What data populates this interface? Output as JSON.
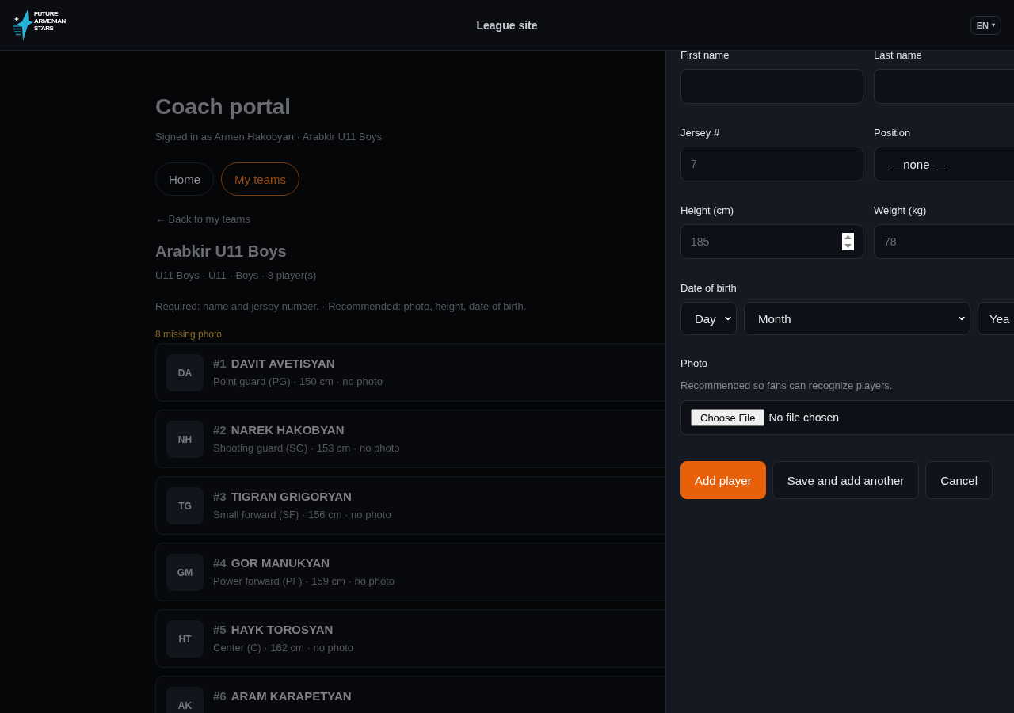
{
  "header": {
    "logo": {
      "lines": [
        "FUTURE",
        "ARMENIAN",
        "STARS"
      ]
    },
    "title": "League site",
    "language": {
      "label": "EN",
      "caret": "▾"
    }
  },
  "page": {
    "title": "Coach portal",
    "subtitle": "Signed in as Armen Hakobyan · Arabkir U11 Boys",
    "tabs": [
      {
        "label": "Home",
        "selected": false
      },
      {
        "label": "My teams",
        "selected": true
      }
    ],
    "back_link": "← Back to my teams",
    "team": {
      "name": "Arabkir U11 Boys",
      "meta": "U11 Boys · U11 · Boys · 8 player(s)",
      "requirements": "Required: name and jersey number. · Recommended: photo, height, date of birth.",
      "missing_notice": "8 missing photo"
    },
    "players": [
      {
        "initials": "DA",
        "number": "#1",
        "name": "DAVIT AVETISYAN",
        "details": "Point guard (PG) · 150 cm · no photo"
      },
      {
        "initials": "NH",
        "number": "#2",
        "name": "NAREK HAKOBYAN",
        "details": "Shooting guard (SG) · 153 cm · no photo"
      },
      {
        "initials": "TG",
        "number": "#3",
        "name": "TIGRAN GRIGORYAN",
        "details": "Small forward (SF) · 156 cm · no photo"
      },
      {
        "initials": "GM",
        "number": "#4",
        "name": "GOR MANUKYAN",
        "details": "Power forward (PF) · 159 cm · no photo"
      },
      {
        "initials": "HT",
        "number": "#5",
        "name": "HAYK TOROSYAN",
        "details": "Center (C) · 162 cm · no photo"
      },
      {
        "initials": "AK",
        "number": "#6",
        "name": "ARAM KARAPETYAN"
      }
    ]
  },
  "drawer": {
    "fields": [
      {
        "label": "First name",
        "kind": "input"
      },
      {
        "label": "Last name",
        "kind": "input"
      },
      {
        "label": "Jersey #",
        "kind": "input",
        "placeholder": "7"
      },
      {
        "label": "Position",
        "kind": "select",
        "value": "— none —"
      },
      {
        "label": "Height (cm)",
        "kind": "stepper",
        "placeholder": "185"
      },
      {
        "label": "Weight (kg)",
        "kind": "input",
        "placeholder": "78"
      }
    ],
    "date_of_birth": {
      "label": "Date of birth",
      "selects": [
        {
          "value": "Day"
        },
        {
          "value": "Month"
        },
        {
          "value": "Yea"
        }
      ]
    },
    "photo": {
      "label": "Photo",
      "hint": "Recommended so fans can recognize players.",
      "button": "Choose File",
      "status": "No file chosen"
    },
    "actions": [
      {
        "label": "Add player",
        "kind": "primary"
      },
      {
        "label": "Save and add another",
        "kind": "secondary"
      },
      {
        "label": "Cancel",
        "kind": "secondary"
      }
    ]
  }
}
